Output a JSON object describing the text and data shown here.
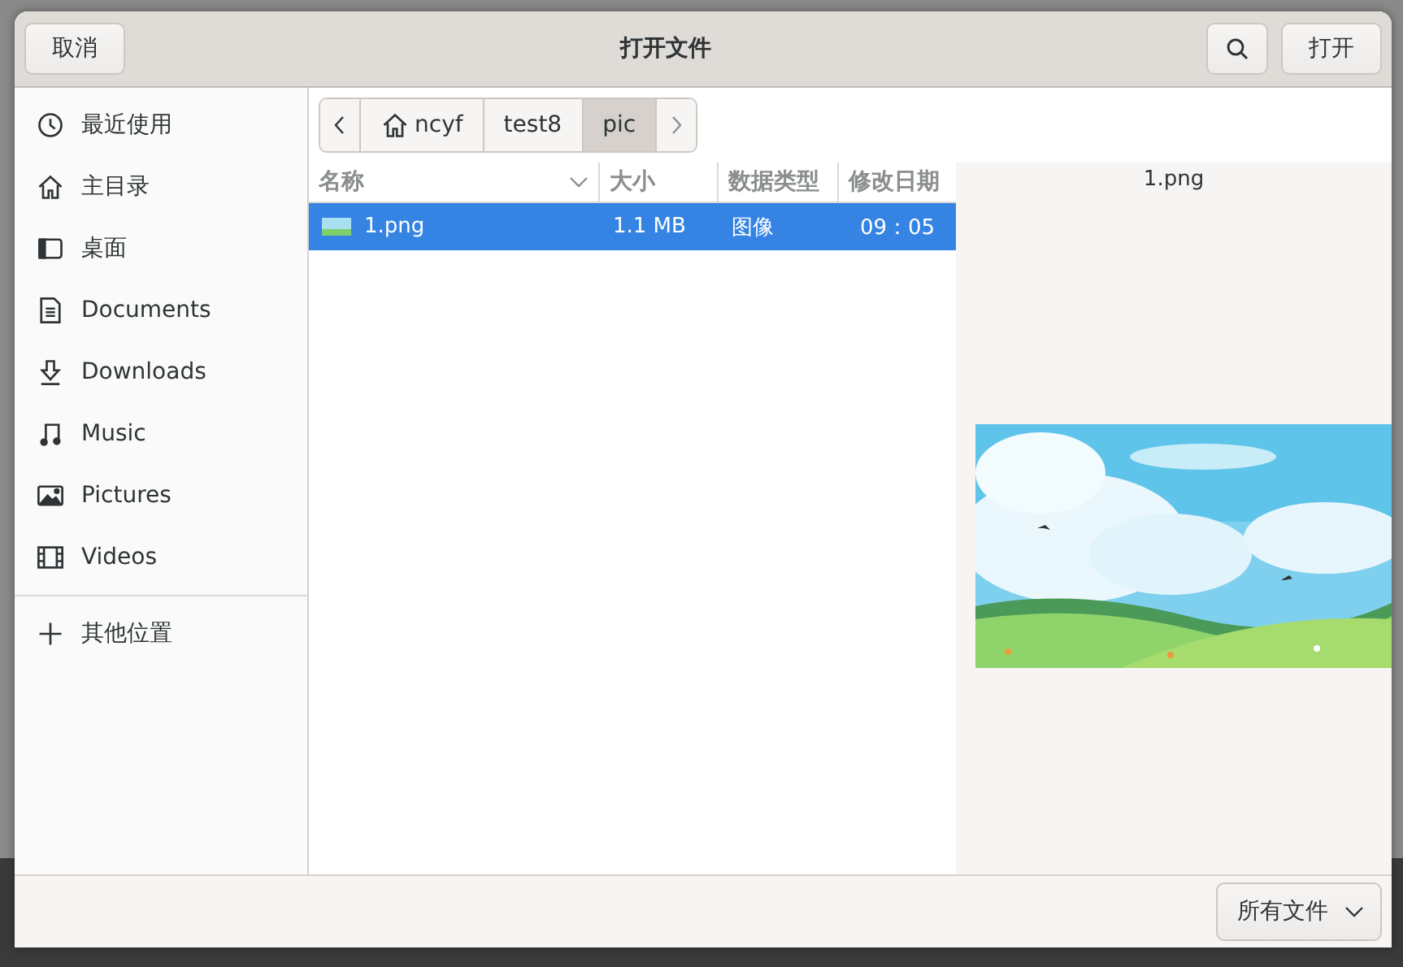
{
  "window": {
    "title": "打开文件",
    "cancel": "取消",
    "open": "打开"
  },
  "sidebar": {
    "items": [
      {
        "kind": "recent",
        "label": "最近使用"
      },
      {
        "kind": "home",
        "label": "主目录"
      },
      {
        "kind": "desktop",
        "label": "桌面"
      },
      {
        "kind": "document",
        "label": "Documents"
      },
      {
        "kind": "download",
        "label": "Downloads"
      },
      {
        "kind": "music",
        "label": "Music"
      },
      {
        "kind": "picture",
        "label": "Pictures"
      },
      {
        "kind": "video",
        "label": "Videos"
      }
    ],
    "other": {
      "label": "其他位置"
    }
  },
  "pathbar": {
    "segments": [
      {
        "label": "ncyf",
        "kind": "home",
        "selected": false
      },
      {
        "label": "test8",
        "kind": "folder",
        "selected": false
      },
      {
        "label": "pic",
        "kind": "folder",
        "selected": true
      }
    ]
  },
  "table": {
    "columns": [
      "名称",
      "大小",
      "数据类型",
      "修改日期"
    ],
    "rows": [
      {
        "name": "1.png",
        "size": "1.1 MB",
        "type": "图像",
        "modified": "09：05",
        "selected": true
      }
    ]
  },
  "preview": {
    "filename": "1.png"
  },
  "filter": {
    "value": "所有文件"
  }
}
